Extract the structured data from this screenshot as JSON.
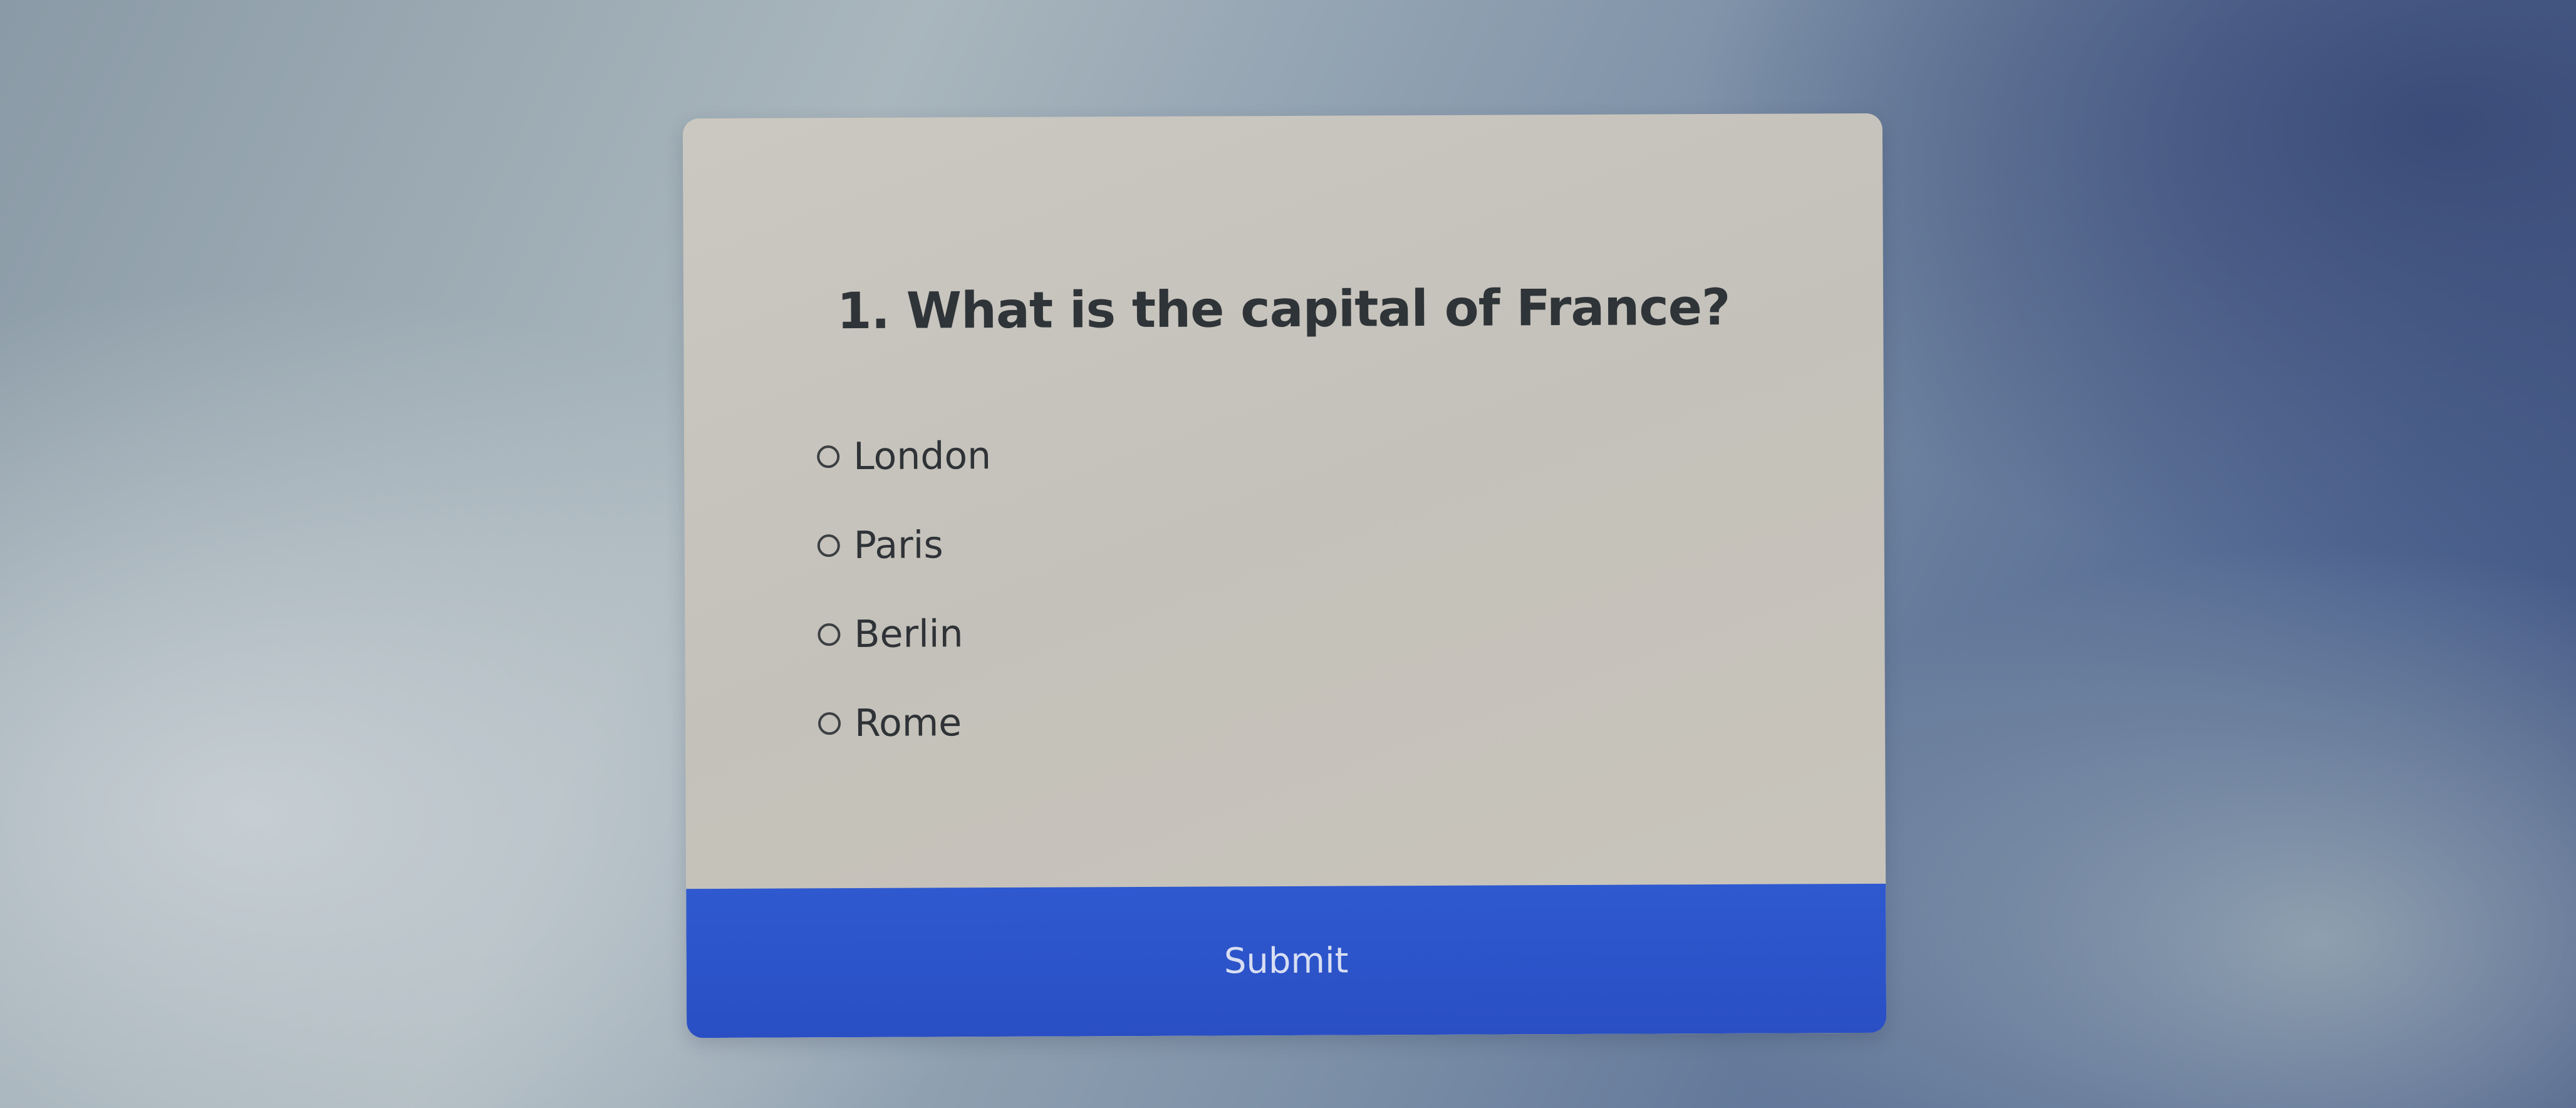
{
  "quiz": {
    "question": "1. What is the capital of France?",
    "options": [
      {
        "label": "London",
        "selected": false
      },
      {
        "label": "Paris",
        "selected": false
      },
      {
        "label": "Berlin",
        "selected": false
      },
      {
        "label": "Rome",
        "selected": false
      }
    ],
    "submit_label": "Submit"
  },
  "colors": {
    "card_background": "#c7c4bd",
    "button_background": "#2c53c9",
    "button_text": "#d8def2",
    "title_text": "#2f3438"
  }
}
